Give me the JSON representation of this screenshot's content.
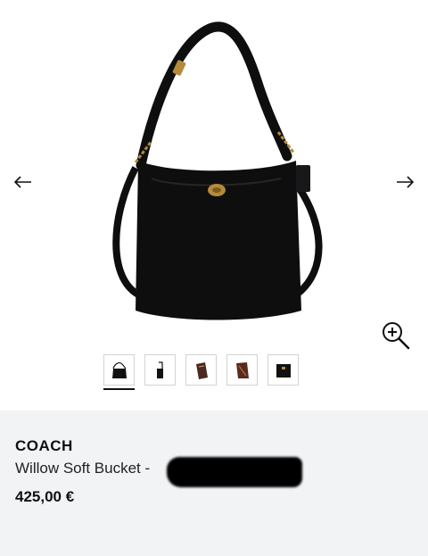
{
  "gallery": {
    "prev_icon": "arrow-left-icon",
    "next_icon": "arrow-right-icon",
    "zoom_icon": "zoom-in-icon",
    "thumbnails": [
      {
        "name": "thumbnail-front",
        "active": true
      },
      {
        "name": "thumbnail-side",
        "active": false
      },
      {
        "name": "thumbnail-detail-1",
        "active": false
      },
      {
        "name": "thumbnail-detail-2",
        "active": false
      },
      {
        "name": "thumbnail-interior",
        "active": false
      }
    ]
  },
  "product": {
    "brand": "COACH",
    "name": "Willow Soft Bucket -",
    "price": "425,00 €"
  },
  "colors": {
    "bag": "#0e0e0f",
    "hardware": "#b68a3a",
    "info_bg": "#f2f3f5"
  }
}
